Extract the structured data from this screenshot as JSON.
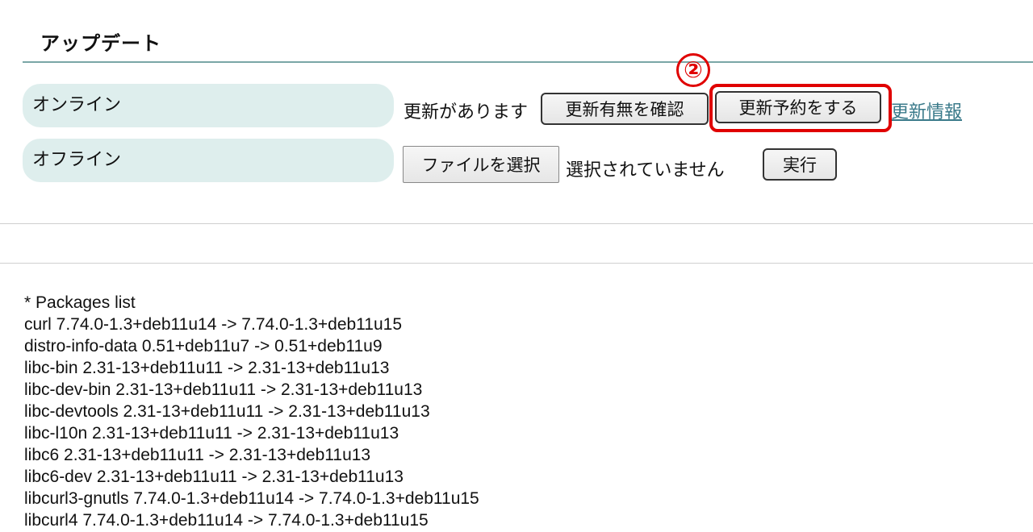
{
  "section": {
    "title": "アップデート"
  },
  "online": {
    "label": "オンライン",
    "status_text": "更新があります",
    "check_button": "更新有無を確認",
    "schedule_button": "更新予約をする",
    "info_link": "更新情報"
  },
  "offline": {
    "label": "オフライン",
    "file_button": "ファイルを選択",
    "file_status": "選択されていません",
    "run_button": "実行"
  },
  "annotation": {
    "marker": "②",
    "color": "#e00000"
  },
  "packages": {
    "header": "* Packages list",
    "items": [
      "curl 7.74.0-1.3+deb11u14 -> 7.74.0-1.3+deb11u15",
      "distro-info-data 0.51+deb11u7 -> 0.51+deb11u9",
      "libc-bin 2.31-13+deb11u11 -> 2.31-13+deb11u13",
      "libc-dev-bin 2.31-13+deb11u11 -> 2.31-13+deb11u13",
      "libc-devtools 2.31-13+deb11u11 -> 2.31-13+deb11u13",
      "libc-l10n 2.31-13+deb11u11 -> 2.31-13+deb11u13",
      "libc6 2.31-13+deb11u11 -> 2.31-13+deb11u13",
      "libc6-dev 2.31-13+deb11u11 -> 2.31-13+deb11u13",
      "libcurl3-gnutls 7.74.0-1.3+deb11u14 -> 7.74.0-1.3+deb11u15",
      "libcurl4 7.74.0-1.3+deb11u14 -> 7.74.0-1.3+deb11u15"
    ]
  },
  "colors": {
    "row_label_bg": "#deeeed",
    "title_rule": "#7aa6a6",
    "link": "#3a7a8a",
    "highlight": "#e00000"
  }
}
